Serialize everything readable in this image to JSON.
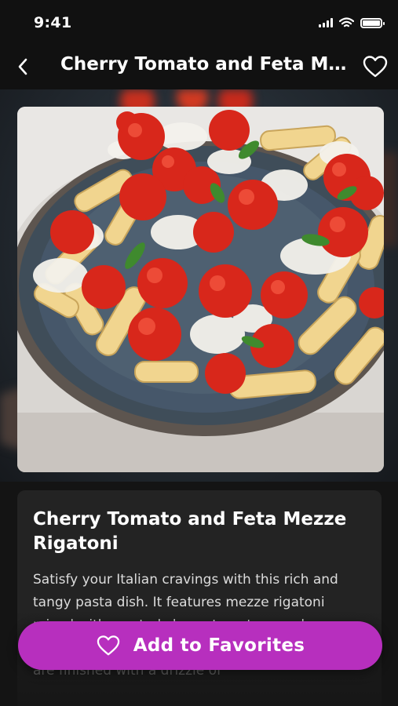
{
  "status_bar": {
    "time": "9:41"
  },
  "nav": {
    "title": "Cherry Tomato and Feta Mezze Rigatoni",
    "back_icon": "chevron-left-icon",
    "favorite_icon": "heart-outline-icon"
  },
  "hero": {
    "image_subject": "pasta-dish-photo"
  },
  "recipe": {
    "title": "Cherry Tomato and Feta Mezze Rigatoni",
    "description": "Satisfy your Italian cravings with this rich and tangy pasta dish. It features mezze rigatoni mixed with roasted cherry tomatoes and crumbled feta cheese. The flavorful ingredients are finished with a drizzle of"
  },
  "actions": {
    "add_to_favorites_label": "Add to Favorites"
  },
  "colors": {
    "accent": "#b72fbe",
    "background": "#141414",
    "card": "#232323"
  }
}
